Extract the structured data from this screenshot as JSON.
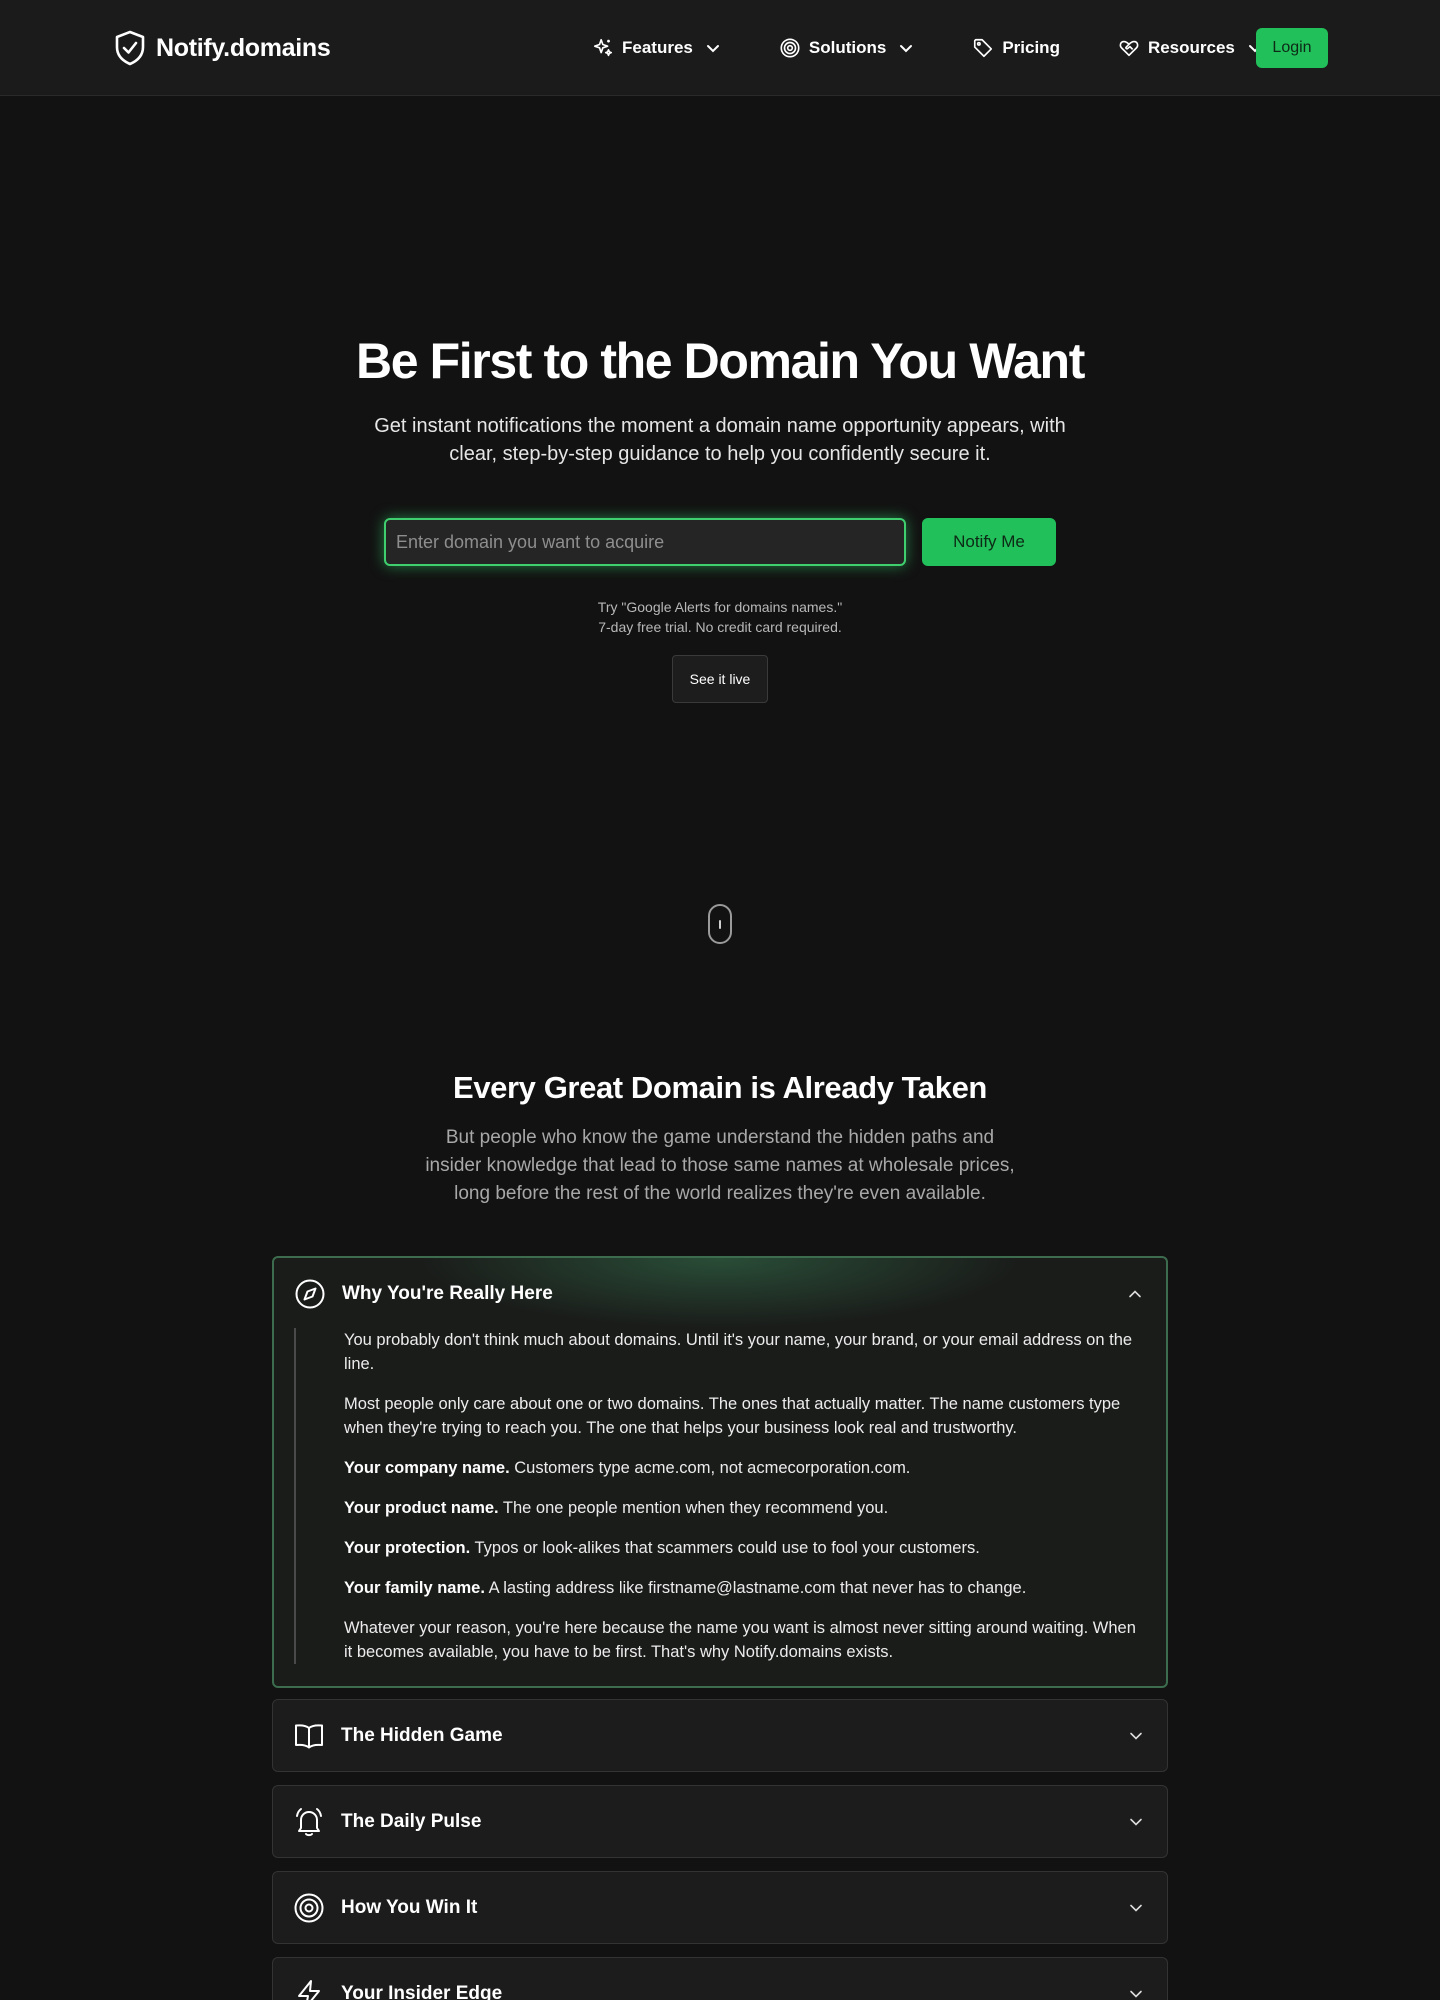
{
  "nav": {
    "brand": "Notify.domains",
    "items": [
      {
        "label": "Features",
        "icon": "sparkles-icon",
        "dropdown": true
      },
      {
        "label": "Solutions",
        "icon": "target-icon",
        "dropdown": true
      },
      {
        "label": "Pricing",
        "icon": "tag-icon",
        "dropdown": false
      },
      {
        "label": "Resources",
        "icon": "heart-handshake-icon",
        "dropdown": true
      }
    ],
    "login": "Login"
  },
  "hero": {
    "title": "Be First to the Domain You Want",
    "subtitle": "Get instant notifications the moment a domain name opportunity appears, with clear, step-by-step guidance to help you confidently secure it.",
    "input_placeholder": "Enter domain you want to acquire",
    "input_value": "",
    "notify_button": "Notify Me",
    "hint_line1": "Try \"Google Alerts for domains names.\"",
    "hint_line2": "7-day free trial. No credit card required.",
    "see_live": "See it live"
  },
  "section": {
    "title": "Every Great Domain is Already Taken",
    "subtitle": "But people who know the game understand the hidden paths and insider knowledge that lead to those same names at wholesale prices, long before the rest of the world realizes they're even available."
  },
  "accordion": [
    {
      "title": "Why You're Really Here",
      "icon": "compass-icon",
      "open": true,
      "paragraphs": [
        {
          "strong": "",
          "text": "You probably don't think much about domains. Until it's your name, your brand, or your email address on the line."
        },
        {
          "strong": "",
          "text": "Most people only care about one or two domains. The ones that actually matter. The name customers type when they're trying to reach you. The one that helps your business look real and trustworthy."
        },
        {
          "strong": "Your company name.",
          "text": " Customers type acme.com, not acmecorporation.com."
        },
        {
          "strong": "Your product name.",
          "text": " The one people mention when they recommend you."
        },
        {
          "strong": "Your protection.",
          "text": " Typos or look-alikes that scammers could use to fool your customers."
        },
        {
          "strong": "Your family name.",
          "text": " A lasting address like firstname@lastname.com that never has to change."
        },
        {
          "strong": "",
          "text": "Whatever your reason, you're here because the name you want is almost never sitting around waiting. When it becomes available, you have to be first. That's why Notify.domains exists."
        }
      ]
    },
    {
      "title": "The Hidden Game",
      "icon": "book-open-icon",
      "open": false
    },
    {
      "title": "The Daily Pulse",
      "icon": "bell-ring-icon",
      "open": false
    },
    {
      "title": "How You Win It",
      "icon": "target-icon",
      "open": false
    },
    {
      "title": "Your Insider Edge",
      "icon": "lightning-icon",
      "open": false
    }
  ]
}
